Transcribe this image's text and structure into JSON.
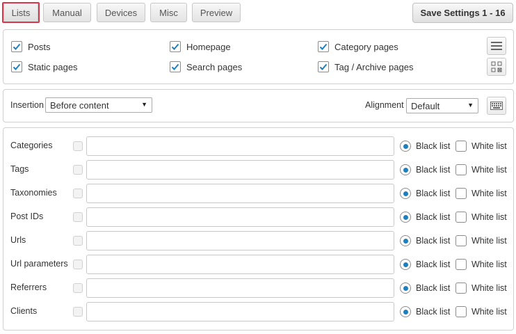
{
  "tabs": [
    {
      "label": "Lists",
      "active": true
    },
    {
      "label": "Manual"
    },
    {
      "label": "Devices"
    },
    {
      "label": "Misc"
    },
    {
      "label": "Preview"
    }
  ],
  "save_button": "Save Settings 1 - 16",
  "page_types": [
    {
      "label": "Posts",
      "checked": true
    },
    {
      "label": "Homepage",
      "checked": true
    },
    {
      "label": "Category pages",
      "checked": true
    },
    {
      "label": "Static pages",
      "checked": true
    },
    {
      "label": "Search pages",
      "checked": true
    },
    {
      "label": "Tag / Archive pages",
      "checked": true
    }
  ],
  "insertion": {
    "label": "Insertion",
    "value": "Before content"
  },
  "alignment": {
    "label": "Alignment",
    "value": "Default"
  },
  "lists": {
    "black_label": "Black list",
    "white_label": "White list",
    "rows": [
      {
        "label": "Categories",
        "value": "",
        "selected": "black"
      },
      {
        "label": "Tags",
        "value": "",
        "selected": "black"
      },
      {
        "label": "Taxonomies",
        "value": "",
        "selected": "black"
      },
      {
        "label": "Post IDs",
        "value": "",
        "selected": "black"
      },
      {
        "label": "Urls",
        "value": "",
        "selected": "black"
      },
      {
        "label": "Url parameters",
        "value": "",
        "selected": "black"
      },
      {
        "label": "Referrers",
        "value": "",
        "selected": "black"
      },
      {
        "label": "Clients",
        "value": "",
        "selected": "black"
      }
    ]
  },
  "colors": {
    "accent": "#1e7fbf",
    "active_outline": "#d9364c"
  },
  "icons": [
    "checkmark-icon",
    "list-icon",
    "grid-icon",
    "keyboard-icon",
    "caret-down-icon"
  ]
}
